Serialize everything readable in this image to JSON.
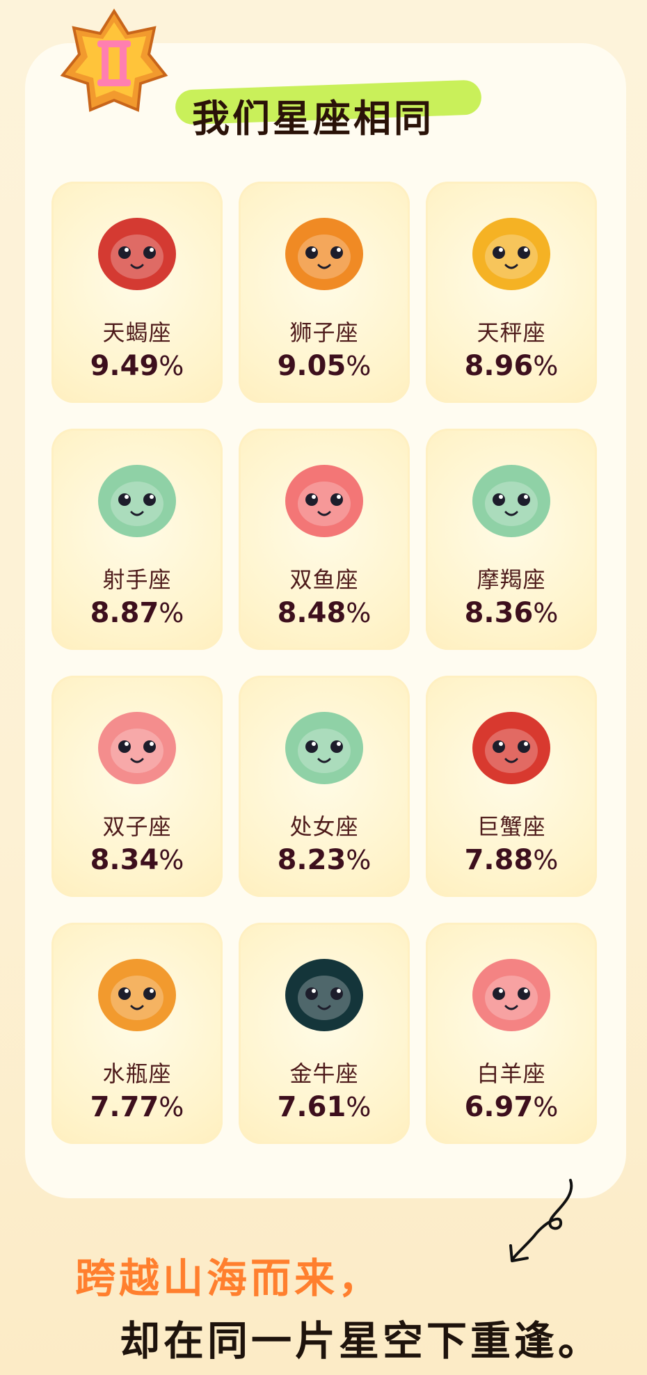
{
  "header": {
    "title": "我们星座相同",
    "badge_icon": "gemini-badge-icon"
  },
  "zodiacs": [
    {
      "name": "天蝎座",
      "percent": "9.49",
      "icon": "scorpio-icon",
      "color": "#d43a32"
    },
    {
      "name": "狮子座",
      "percent": "9.05",
      "icon": "leo-icon",
      "color": "#f08a24"
    },
    {
      "name": "天秤座",
      "percent": "8.96",
      "icon": "libra-icon",
      "color": "#f5b224"
    },
    {
      "name": "射手座",
      "percent": "8.87",
      "icon": "sagittarius-icon",
      "color": "#8fd1a6"
    },
    {
      "name": "双鱼座",
      "percent": "8.48",
      "icon": "pisces-icon",
      "color": "#f37676"
    },
    {
      "name": "摩羯座",
      "percent": "8.36",
      "icon": "capricorn-icon",
      "color": "#8fd1a6"
    },
    {
      "name": "双子座",
      "percent": "8.34",
      "icon": "gemini-icon",
      "color": "#f48d8d"
    },
    {
      "name": "处女座",
      "percent": "8.23",
      "icon": "virgo-icon",
      "color": "#8fd1a6"
    },
    {
      "name": "巨蟹座",
      "percent": "7.88",
      "icon": "cancer-icon",
      "color": "#d8392f"
    },
    {
      "name": "水瓶座",
      "percent": "7.77",
      "icon": "aquarius-icon",
      "color": "#f29a2e"
    },
    {
      "name": "金牛座",
      "percent": "7.61",
      "icon": "taurus-icon",
      "color": "#14353a"
    },
    {
      "name": "白羊座",
      "percent": "6.97",
      "icon": "aries-icon",
      "color": "#f48383"
    }
  ],
  "percent_sign": "%",
  "footer": {
    "line1": "跨越山海而来，",
    "line2": "却在同一片星空下重逢。",
    "doodle_icon": "arrow-doodle-icon"
  }
}
